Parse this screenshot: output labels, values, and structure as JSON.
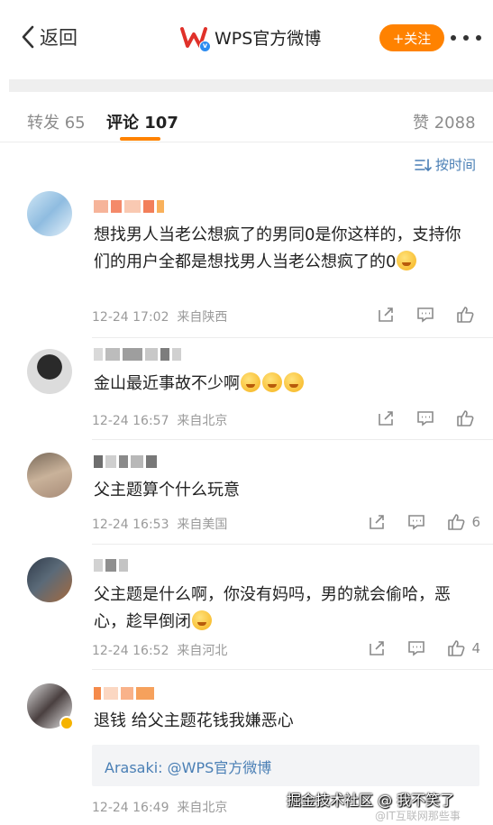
{
  "nav": {
    "back_label": "返回",
    "title": "WPS官方微博",
    "follow_label": "+关注"
  },
  "tabs": {
    "repost": "转发 65",
    "comments": "评论 107",
    "likes": "赞 2088"
  },
  "sort_label": "按时间",
  "colors": {
    "accent": "#ff8200",
    "link": "#4a7fb5"
  },
  "comments": [
    {
      "text": "想找男人当老公想疯了的男同0是你这样的，支持你们的用户全都是想找男人当老公想疯了的0",
      "date": "12-24 17:02",
      "location": "来自陕西",
      "likes": ""
    },
    {
      "text": "金山最近事故不少啊",
      "date": "12-24 16:57",
      "location": "来自北京",
      "likes": ""
    },
    {
      "text": "父主题算个什么玩意",
      "date": "12-24 16:53",
      "location": "来自美国",
      "likes": "6"
    },
    {
      "text": "父主题是什么啊，你没有妈吗，男的就会偷哈，恶心，趁早倒闭",
      "date": "12-24 16:52",
      "location": "来自河北",
      "likes": "4"
    },
    {
      "text": "退钱 给父主题花钱我嫌恶心",
      "date": "12-24 16:49",
      "location": "来自北京",
      "likes": ""
    }
  ],
  "reply_preview": "Arasaki: @WPS官方微博",
  "watermark": "掘金技术社区 @ 我不笑了",
  "watermark_small": "@IT互联网那些事"
}
